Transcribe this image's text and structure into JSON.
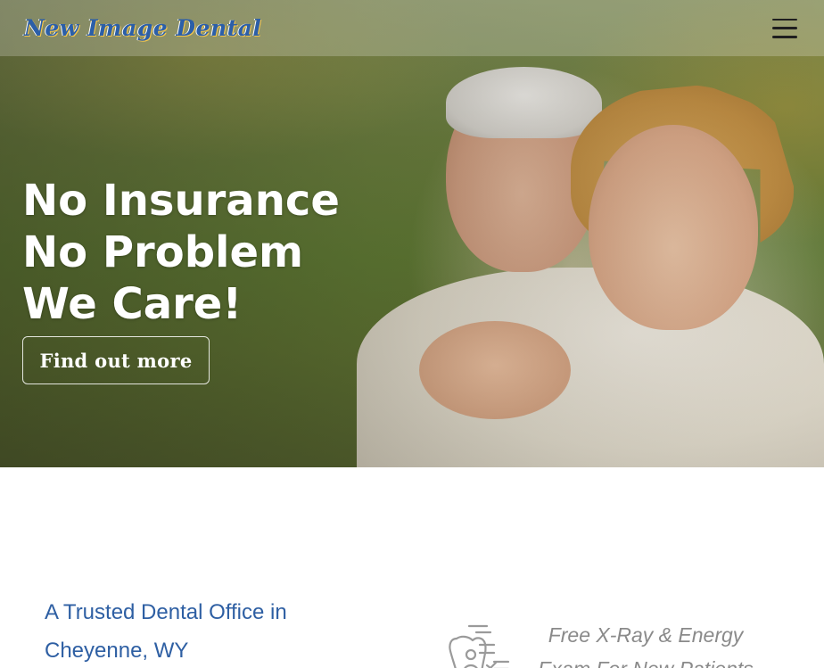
{
  "header": {
    "logo_text": "New Image Dental",
    "menu_icon": "hamburger-menu-icon"
  },
  "hero": {
    "headline_lines": [
      "No Insurance",
      "No Problem",
      "We Care!"
    ],
    "cta_label": "Find out more"
  },
  "intro": {
    "heading": "A Trusted Dental Office in Cheyenne, WY"
  },
  "offer": {
    "icon": "tooth-checklist-icon",
    "text": "Free X-Ray & Energy Exam For New Patients"
  },
  "colors": {
    "brand_blue": "#2e5fa3",
    "offer_gray": "#8a8a8a",
    "menu_icon": "#1f1f1f"
  }
}
